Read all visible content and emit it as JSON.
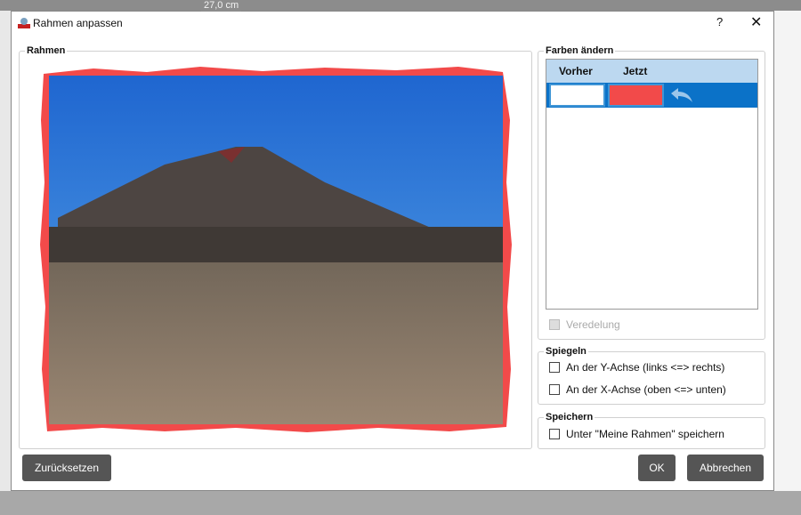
{
  "background": {
    "ruler_text": "27,0 cm"
  },
  "dialog": {
    "title": "Rahmen anpassen",
    "help": "?",
    "close": "✕"
  },
  "frame_group": {
    "legend": "Rahmen"
  },
  "colors": {
    "legend": "Farben ändern",
    "col_before": "Vorher",
    "col_now": "Jetzt",
    "before_color": "#ffffff",
    "now_color": "#f24a4a",
    "undo_icon": "undo-arrow",
    "refine_label": "Veredelung"
  },
  "mirror": {
    "legend": "Spiegeln",
    "y_axis": "An der Y-Achse (links <=> rechts)",
    "x_axis": "An der X-Achse (oben <=> unten)"
  },
  "save": {
    "legend": "Speichern",
    "my_frames": "Unter \"Meine Rahmen\" speichern"
  },
  "buttons": {
    "reset": "Zurücksetzen",
    "ok": "OK",
    "cancel": "Abbrechen"
  }
}
